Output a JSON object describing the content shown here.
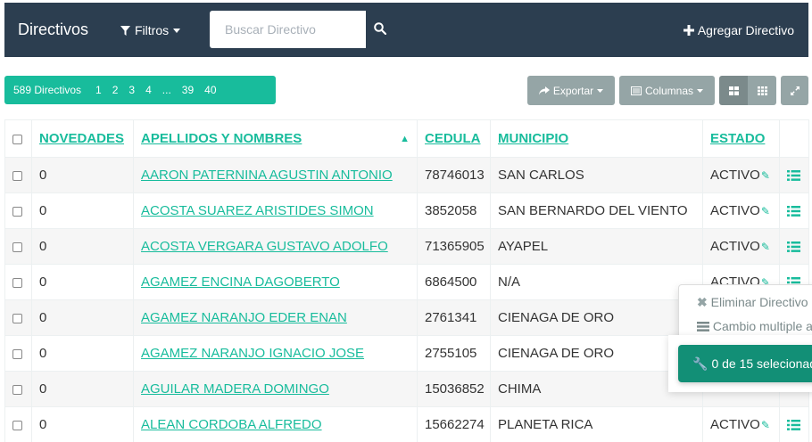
{
  "navbar": {
    "brand": "Directivos",
    "filters_label": "Filtros",
    "search_placeholder": "Buscar Directivo",
    "add_label": "Agregar Directivo"
  },
  "toolbar": {
    "count_label": "589 Directivos",
    "pages": [
      "1",
      "2",
      "3",
      "4",
      "...",
      "39",
      "40"
    ],
    "export_label": "Exportar",
    "columns_label": "Columnas"
  },
  "table": {
    "headers": {
      "novedades": "NOVEDADES",
      "nombres": "APELLIDOS Y NOMBRES",
      "cedula": "CEDULA",
      "municipio": "MUNICIPIO",
      "estado": "ESTADO"
    },
    "rows": [
      {
        "novedades": "0",
        "nombres": "AARON PATERNINA AGUSTIN ANTONIO",
        "cedula": "78746013",
        "municipio": "SAN CARLOS",
        "estado": "ACTIVO"
      },
      {
        "novedades": "0",
        "nombres": "ACOSTA SUAREZ ARISTIDES SIMON",
        "cedula": "3852058",
        "municipio": "SAN BERNARDO DEL VIENTO",
        "estado": "ACTIVO"
      },
      {
        "novedades": "0",
        "nombres": "ACOSTA VERGARA GUSTAVO ADOLFO",
        "cedula": "71365905",
        "municipio": "AYAPEL",
        "estado": "ACTIVO"
      },
      {
        "novedades": "0",
        "nombres": "AGAMEZ ENCINA DAGOBERTO",
        "cedula": "6864500",
        "municipio": "N/A",
        "estado": "ACTIVO"
      },
      {
        "novedades": "0",
        "nombres": "AGAMEZ NARANJO EDER ENAN",
        "cedula": "2761341",
        "municipio": "CIENAGA DE ORO",
        "estado": ""
      },
      {
        "novedades": "0",
        "nombres": "AGAMEZ NARANJO IGNACIO JOSE",
        "cedula": "2755105",
        "municipio": "CIENAGA DE ORO",
        "estado": ""
      },
      {
        "novedades": "0",
        "nombres": "AGUILAR MADERA DOMINGO",
        "cedula": "15036852",
        "municipio": "CHIMA",
        "estado": ""
      },
      {
        "novedades": "0",
        "nombres": "ALEAN CORDOBA ALFREDO",
        "cedula": "15662274",
        "municipio": "PLANETA RICA",
        "estado": "ACTIVO"
      }
    ]
  },
  "dropdown": {
    "delete_label": "Eliminar Directivo",
    "bulk_label": "Cambio multiple a",
    "selected_label": "0 de 15 selecionad"
  },
  "colors": {
    "navbar": "#2c3e50",
    "accent": "#18bc9c",
    "toolbar_button": "#95a5a6",
    "toolbar_button_dark": "#7b8a8b",
    "selected_button": "#128f76"
  }
}
